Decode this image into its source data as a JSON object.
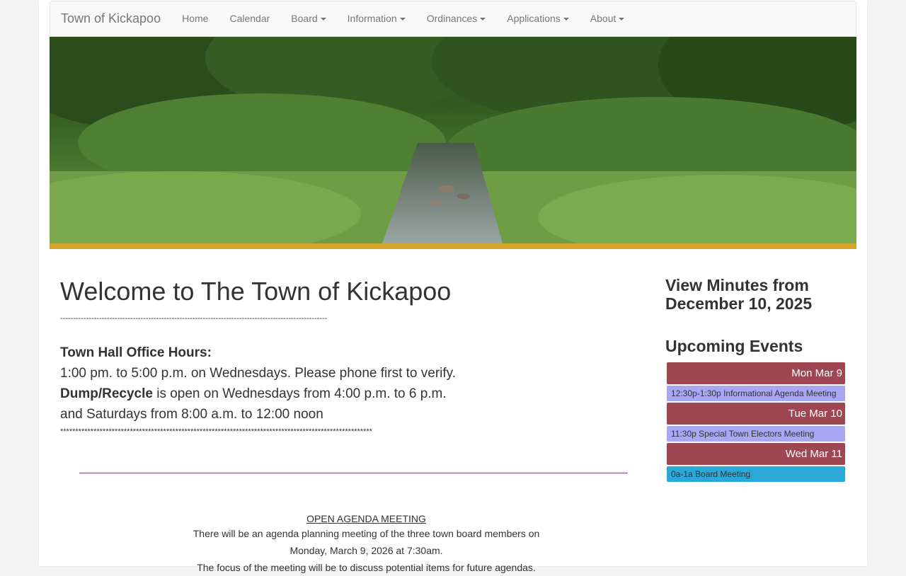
{
  "navbar": {
    "brand": "Town of Kickapoo",
    "items": [
      {
        "label": "Home",
        "dropdown": false
      },
      {
        "label": "Calendar",
        "dropdown": false
      },
      {
        "label": "Board",
        "dropdown": true
      },
      {
        "label": "Information",
        "dropdown": true
      },
      {
        "label": "Ordinances",
        "dropdown": true
      },
      {
        "label": "Applications",
        "dropdown": true
      },
      {
        "label": "About",
        "dropdown": true
      }
    ]
  },
  "banner": {
    "description_icon": "creek-landscape-photo"
  },
  "colors": {
    "gold": "#d4a42b",
    "day_header": "#9e4652",
    "event_purple": "#a7a7f3",
    "event_blue": "#2aa8d8",
    "rule_purple": "#7a3d8c"
  },
  "main": {
    "title": "Welcome to The Town of Kickapoo",
    "dashes": "-------------------------------------------------------------------------------------------------------",
    "office_hours_label": "Town Hall Office Hours:",
    "office_hours_text": "1:00 pm. to 5:00 p.m. on Wednesdays.  Please phone first to verify.",
    "dump_label": "Dump/Recycle",
    "dump_text": " is open on Wednesdays from 4:00 p.m. to 6 p.m.",
    "saturday_text": "and Saturdays from 8:00 a.m. to 12:00 noon",
    "stars": "*******************************************************************************************************",
    "agenda": {
      "title": "OPEN AGENDA MEETING",
      "line1": "There will be an agenda planning meeting of the three town board members on",
      "line2": "Monday, March 9, 2026 at 7:30am.",
      "line3": "The focus of the meeting will be to discuss potential items for future agendas."
    }
  },
  "sidebar": {
    "minutes_heading": "View Minutes from December 10, 2025",
    "events_heading": "Upcoming Events",
    "days": [
      {
        "label": "Mon Mar 9",
        "events": [
          {
            "time": "12:30p-1:30p",
            "title": "Informational Agenda Meeting",
            "color": "purple"
          }
        ]
      },
      {
        "label": "Tue Mar 10",
        "events": [
          {
            "time": "11:30p",
            "title": "Special Town Electors Meeting",
            "color": "purple"
          }
        ]
      },
      {
        "label": "Wed Mar 11",
        "events": [
          {
            "time": "0a-1a",
            "title": "Board Meeting",
            "color": "blue"
          }
        ]
      }
    ]
  }
}
